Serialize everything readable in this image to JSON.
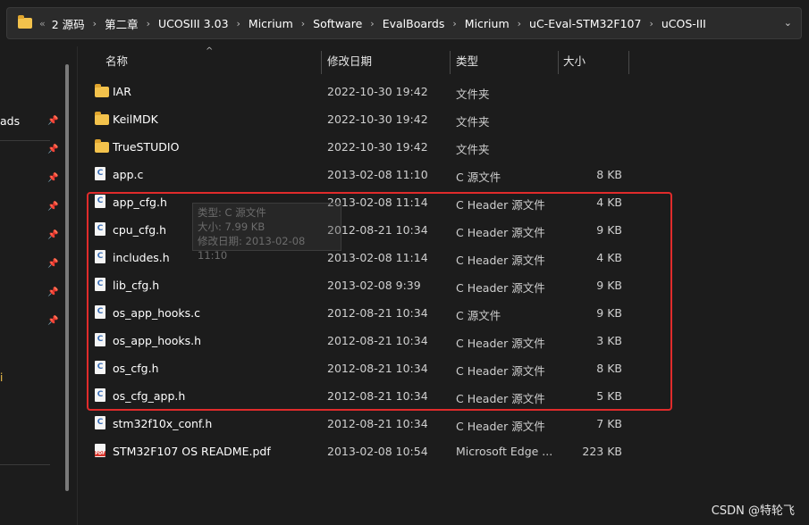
{
  "address_bar": {
    "overflow": "«",
    "crumbs": [
      "2 源码",
      "第二章",
      "UCOSIII 3.03",
      "Micrium",
      "Software",
      "EvalBoards",
      "Micrium",
      "uC-Eval-STM32F107",
      "uCOS-III"
    ],
    "separator": "›",
    "dropdown": "⌄"
  },
  "nav": {
    "partial_label": "ads",
    "partial_label_2": "i"
  },
  "columns": {
    "name": "名称",
    "modified": "修改日期",
    "type": "类型",
    "size": "大小"
  },
  "files": [
    {
      "name": "IAR",
      "modified": "2022-10-30 19:42",
      "type": "文件夹",
      "size": "",
      "icon": "folder-icon"
    },
    {
      "name": "KeilMDK",
      "modified": "2022-10-30 19:42",
      "type": "文件夹",
      "size": "",
      "icon": "folder-icon"
    },
    {
      "name": "TrueSTUDIO",
      "modified": "2022-10-30 19:42",
      "type": "文件夹",
      "size": "",
      "icon": "folder-icon"
    },
    {
      "name": "app.c",
      "modified": "2013-02-08 11:10",
      "type": "C 源文件",
      "size": "8 KB",
      "icon": "c-file-icon"
    },
    {
      "name": "app_cfg.h",
      "modified": "2013-02-08 11:14",
      "type": "C Header 源文件",
      "size": "4 KB",
      "icon": "c-file-icon"
    },
    {
      "name": "cpu_cfg.h",
      "modified": "2012-08-21 10:34",
      "type": "C Header 源文件",
      "size": "9 KB",
      "icon": "c-file-icon"
    },
    {
      "name": "includes.h",
      "modified": "2013-02-08 11:14",
      "type": "C Header 源文件",
      "size": "4 KB",
      "icon": "c-file-icon"
    },
    {
      "name": "lib_cfg.h",
      "modified": "2013-02-08 9:39",
      "type": "C Header 源文件",
      "size": "9 KB",
      "icon": "c-file-icon"
    },
    {
      "name": "os_app_hooks.c",
      "modified": "2012-08-21 10:34",
      "type": "C 源文件",
      "size": "9 KB",
      "icon": "c-file-icon"
    },
    {
      "name": "os_app_hooks.h",
      "modified": "2012-08-21 10:34",
      "type": "C Header 源文件",
      "size": "3 KB",
      "icon": "c-file-icon"
    },
    {
      "name": "os_cfg.h",
      "modified": "2012-08-21 10:34",
      "type": "C Header 源文件",
      "size": "8 KB",
      "icon": "c-file-icon"
    },
    {
      "name": "os_cfg_app.h",
      "modified": "2012-08-21 10:34",
      "type": "C Header 源文件",
      "size": "5 KB",
      "icon": "c-file-icon"
    },
    {
      "name": "stm32f10x_conf.h",
      "modified": "2012-08-21 10:34",
      "type": "C Header 源文件",
      "size": "7 KB",
      "icon": "c-file-icon"
    },
    {
      "name": "STM32F107 OS README.pdf",
      "modified": "2013-02-08 10:54",
      "type": "Microsoft Edge ...",
      "size": "223 KB",
      "icon": "pdf-file-icon"
    }
  ],
  "tooltip": {
    "line1": "类型: C 源文件",
    "line2": "大小: 7.99 KB",
    "line3": "修改日期: 2013-02-08 11:10"
  },
  "watermark": "CSDN @特轮飞",
  "colors": {
    "background": "#1c1c1c",
    "highlight": "#e02b2b",
    "folder": "#f3c24c"
  }
}
